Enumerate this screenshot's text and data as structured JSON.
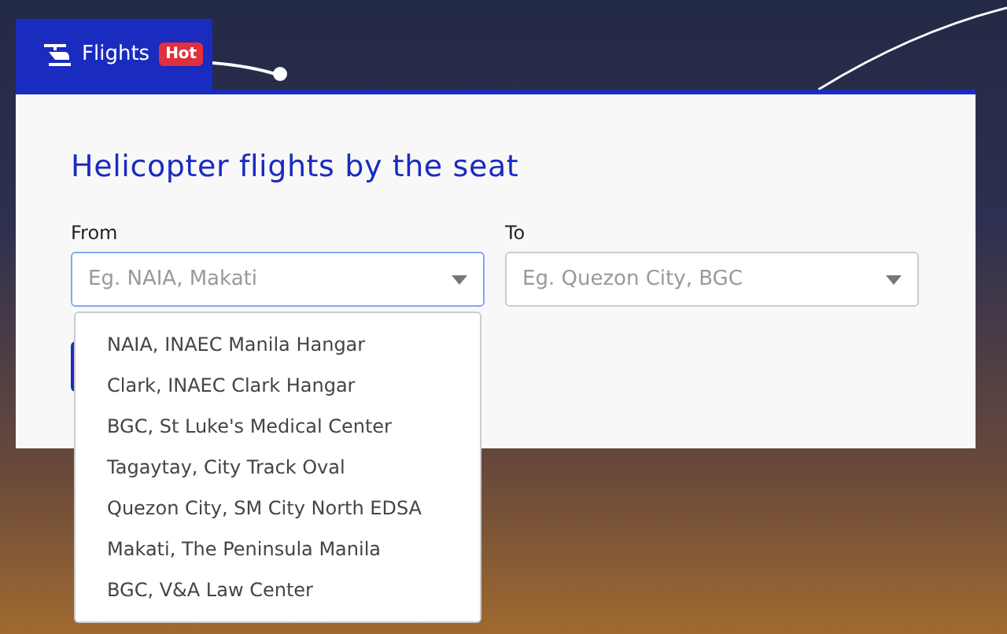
{
  "tabs": [
    {
      "label": "Flights",
      "badge": "Hot",
      "selected": true
    }
  ],
  "title": "Helicopter flights by the seat",
  "fields": [
    {
      "label": "From",
      "placeholder": "Eg. NAIA, Makati",
      "focused": true
    },
    {
      "label": "To",
      "placeholder": "Eg. Quezon City, BGC",
      "focused": false
    }
  ],
  "dropdown": {
    "options": [
      "NAIA, INAEC Manila Hangar",
      "Clark, INAEC Clark Hangar",
      "BGC, St Luke's Medical Center",
      "Tagaytay, City Track Oval",
      "Quezon City, SM City North EDSA",
      "Makati, The Peninsula Manila",
      "BGC, V&A Law Center"
    ]
  }
}
